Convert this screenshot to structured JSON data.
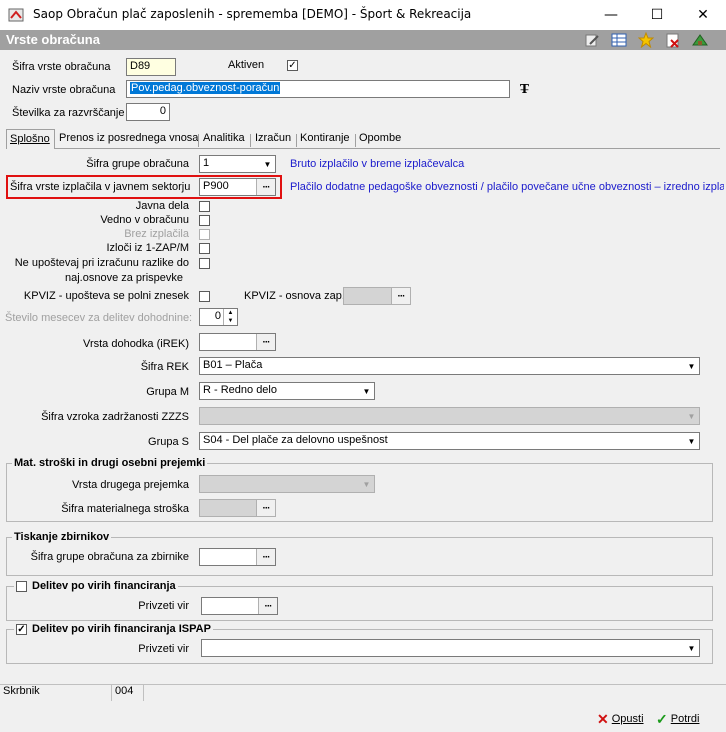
{
  "window": {
    "title": "Saop Obračun plač zaposlenih - sprememba [DEMO] - Šport & Rekreacija",
    "minimize": "—",
    "maximize": "☐",
    "close": "✕"
  },
  "header": {
    "title": "Vrste obračuna"
  },
  "form": {
    "sifra_label": "Šifra vrste obračuna",
    "sifra_value": "D89",
    "aktiven_label": "Aktiven",
    "aktiven_checked": "✓",
    "naziv_label": "Naziv vrste obračuna",
    "naziv_value": "Pov.pedag.obveznost-poračun",
    "stevilka_label": "Številka  za razvrščanje",
    "stevilka_value": "0"
  },
  "tabs": [
    {
      "label": "Splošno"
    },
    {
      "label": "Prenos iz posrednega vnosa"
    },
    {
      "label": "Analitika"
    },
    {
      "label": "Izračun"
    },
    {
      "label": "Kontiranje"
    },
    {
      "label": "Opombe"
    }
  ],
  "general": {
    "grupa_label": "Šifra grupe obračuna",
    "grupa_value": "1",
    "grupa_desc": "Bruto izplačilo v breme izplačevalca",
    "izplacila_label": "Šifra vrste izplačila v javnem sektorju",
    "izplacila_value": "P900",
    "izplacila_desc": "Plačilo dodatne pedagoške obveznosti / plačilo povečane učne obveznosti – izredno izplačilo",
    "javna_dela": "Javna dela",
    "vedno": "Vedno v obračunu",
    "brez": "Brez izplačila",
    "izloci": "Izloči iz 1-ZAP/M",
    "ne_upostevaj_1": "Ne upoštevaj pri izračunu razlike do",
    "ne_upostevaj_2": "naj.osnove za prispevke",
    "kpviz_label": "KPVIZ - upošteva se polni znesek",
    "kpviz_osnova_label": "KPVIZ - osnova zap.",
    "stevilo_mesecev_label": "Število mesecev za delitev dohodnine:",
    "stevilo_mesecev_value": "0",
    "vrsta_dohodka_label": "Vrsta dohodka (iREK)",
    "sifra_rek_label": "Šifra REK",
    "sifra_rek_value": "B01 – Plača",
    "grupa_m_label": "Grupa M",
    "grupa_m_value": "R - Redno delo",
    "zzzs_label": "Šifra vzroka zadržanosti ZZZS",
    "grupa_s_label": "Grupa S",
    "grupa_s_value": "S04 - Del plače za delovno uspešnost"
  },
  "mat": {
    "title": "Mat. stroški in drugi osebni prejemki",
    "vrsta_label": "Vrsta drugega prejemka",
    "sifra_label": "Šifra materialnega stroška"
  },
  "tisk": {
    "title": "Tiskanje zbirnikov",
    "sifra_label": "Šifra grupe obračuna za zbirnike"
  },
  "delitev": {
    "title": "Delitev po virih financiranja",
    "vir_label": "Privzeti vir"
  },
  "delitev_ispap": {
    "title": "Delitev po virih financiranja ISPAP",
    "checked": "✓",
    "vir_label": "Privzeti vir"
  },
  "status": {
    "skrbnik_label": "Skrbnik",
    "skrbnik_value": "004"
  },
  "footer": {
    "cancel": "Opusti",
    "confirm": "Potrdi"
  },
  "icons": {
    "app": "app-icon",
    "edit": "edit-icon",
    "table": "table-icon",
    "favorite": "star-icon",
    "delete": "delete-icon",
    "exit": "exit-icon"
  },
  "colors": {
    "highlight_border": "#e01010",
    "selection": "#0078d7",
    "description_text": "#1a1acc"
  }
}
